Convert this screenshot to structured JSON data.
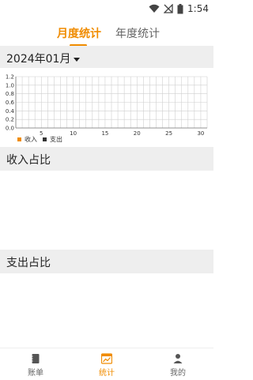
{
  "status": {
    "time": "1:54"
  },
  "tabs": {
    "active": "月度统计",
    "inactive": "年度统计"
  },
  "month_selector": {
    "label": "2024年01月"
  },
  "chart_data": {
    "type": "bar",
    "x": [
      5,
      10,
      15,
      20,
      25,
      30
    ],
    "xlim": [
      1,
      31
    ],
    "ylim": [
      0,
      1.2
    ],
    "y_ticks": [
      "0.0",
      "0.2",
      "0.4",
      "0.6",
      "0.8",
      "1.0",
      "1.2"
    ],
    "x_ticks": [
      "5",
      "10",
      "15",
      "20",
      "25",
      "30"
    ],
    "series": [
      {
        "name": "收入",
        "color": "#f08c00",
        "values": []
      },
      {
        "name": "支出",
        "color": "#333333",
        "values": []
      }
    ],
    "grid": true,
    "legend": "bottom-left"
  },
  "sections": {
    "income": "收入占比",
    "expense": "支出占比"
  },
  "navbar": {
    "items": [
      {
        "label": "账单"
      },
      {
        "label": "统计"
      },
      {
        "label": "我的"
      }
    ]
  },
  "colors": {
    "accent": "#f08c00",
    "section_bg": "#eeeeee"
  }
}
